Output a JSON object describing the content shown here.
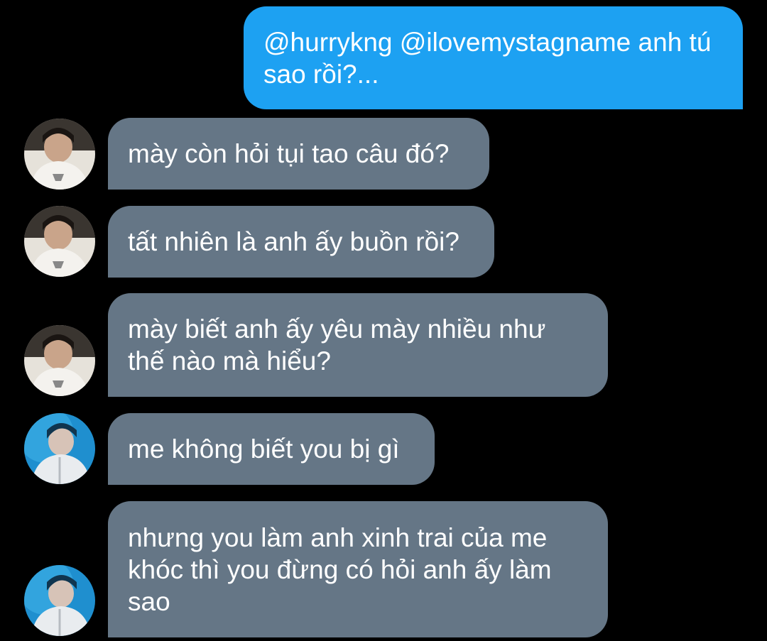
{
  "conversation": {
    "messages": [
      {
        "sender": "self",
        "text": "@hurrykng @ilovemystagname anh tú sao rồi?..."
      },
      {
        "sender": "contact_a",
        "text": "mày còn hỏi tụi tao câu đó?"
      },
      {
        "sender": "contact_a",
        "text": "tất nhiên là anh ấy buồn rồi?"
      },
      {
        "sender": "contact_a",
        "text": "mày biết anh ấy yêu mày nhiều như thế nào mà hiểu?"
      },
      {
        "sender": "contact_b",
        "text": "me không biết you bị gì"
      },
      {
        "sender": "contact_b",
        "text": "nhưng you làm anh xinh trai của me khóc thì you đừng có hỏi anh ấy làm sao"
      }
    ]
  },
  "colors": {
    "background": "#000000",
    "outgoing_bubble": "#1da1f2",
    "incoming_bubble": "#657686",
    "text": "#ffffff"
  },
  "icons": {
    "avatar_a": "avatar-photo-boy-white-shirt",
    "avatar_b": "avatar-photo-boy-blue-stage-light"
  }
}
